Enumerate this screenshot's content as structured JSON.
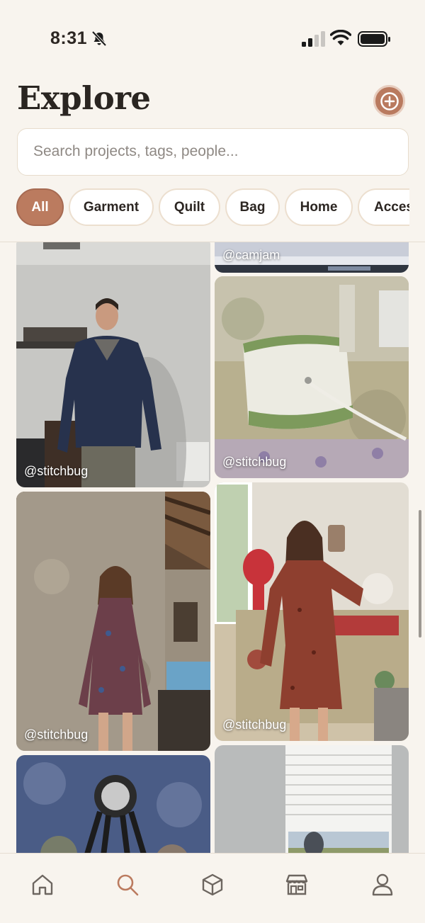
{
  "status_bar": {
    "time": "8:31"
  },
  "header": {
    "title": "Explore",
    "add_icon": "plus-circle-icon"
  },
  "search": {
    "placeholder": "Search projects, tags, people..."
  },
  "filters": [
    {
      "label": "All",
      "active": true
    },
    {
      "label": "Garment",
      "active": false
    },
    {
      "label": "Quilt",
      "active": false
    },
    {
      "label": "Bag",
      "active": false
    },
    {
      "label": "Home",
      "active": false
    },
    {
      "label": "Accessories",
      "active": false
    }
  ],
  "feed": [
    {
      "user": "@camjam"
    },
    {
      "user": "@stitchbug"
    },
    {
      "user": "@stitchbug"
    },
    {
      "user": "@stitchbug"
    },
    {
      "user": "@stitchbug"
    },
    {
      "user": ""
    },
    {
      "user": ""
    }
  ],
  "tabs": [
    {
      "icon": "home-icon",
      "active": false
    },
    {
      "icon": "search-icon",
      "active": true
    },
    {
      "icon": "box-icon",
      "active": false
    },
    {
      "icon": "store-icon",
      "active": false
    },
    {
      "icon": "profile-icon",
      "active": false
    }
  ],
  "colors": {
    "accent": "#bb7b5f",
    "background": "#f8f4ee",
    "inactive_icon": "#6d6660"
  }
}
